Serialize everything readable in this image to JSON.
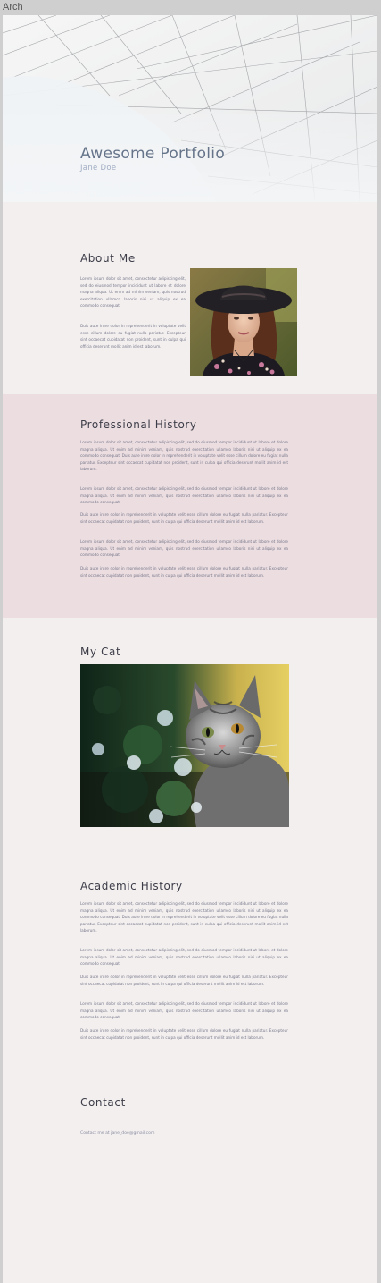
{
  "window": {
    "title": "Arch"
  },
  "hero": {
    "title": "Awesome Portfolio",
    "subtitle": "Jane Doe"
  },
  "about": {
    "heading": "About Me",
    "paragraphs": [
      "Lorem ipsum dolor sit amet, consectetur adipiscing elit, sed do eiusmod tempor incididunt ut labore et dolore magna aliqua. Ut enim ad minim veniam, quis nostrud exercitation ullamco laboris nisi ut aliquip ex ea commodo consequat.",
      "Duis aute irure dolor in reprehenderit in voluptate velit esse cillum dolore eu fugiat nulla pariatur. Excepteur sint occaecat cupidatat non proident, sunt in culpa qui officia deserunt mollit anim id est laborum."
    ],
    "photo_alt": "portrait-woman-hat"
  },
  "professional": {
    "heading": "Professional History",
    "paragraphs": [
      "Lorem ipsum dolor sit amet, consectetur adipiscing elit, sed do eiusmod tempor incididunt ut labore et dolore magna aliqua. Ut enim ad minim veniam, quis nostrud exercitation ullamco laboris nisi ut aliquip ex ea commodo consequat. Duis aute irure dolor in reprehenderit in voluptate velit esse cillum dolore eu fugiat nulla pariatur. Excepteur sint occaecat cupidatat non proident, sunt in culpa qui officia deserunt mollit anim id est laborum.",
      "Lorem ipsum dolor sit amet, consectetur adipiscing elit, sed do eiusmod tempor incididunt ut labore et dolore magna aliqua. Ut enim ad minim veniam, quis nostrud exercitation ullamco laboris nisi ut aliquip ex ea commodo consequat.",
      "Duis aute irure dolor in reprehenderit in voluptate velit esse cillum dolore eu fugiat nulla pariatur. Excepteur sint occaecat cupidatat non proident, sunt in culpa qui officia deserunt mollit anim id est laborum.",
      "Lorem ipsum dolor sit amet, consectetur adipiscing elit, sed do eiusmod tempor incididunt ut labore et dolore magna aliqua. Ut enim ad minim veniam, quis nostrud exercitation ullamco laboris nisi ut aliquip ex ea commodo consequat.",
      "Duis aute irure dolor in reprehenderit in voluptate velit esse cillum dolore eu fugiat nulla pariatur. Excepteur sint occaecat cupidatat non proident, sunt in culpa qui officia deserunt mollit anim id est laborum."
    ]
  },
  "cat": {
    "heading": "My Cat",
    "photo_alt": "cat-photo"
  },
  "academic": {
    "heading": "Academic History",
    "paragraphs": [
      "Lorem ipsum dolor sit amet, consectetur adipiscing elit, sed do eiusmod tempor incididunt ut labore et dolore magna aliqua. Ut enim ad minim veniam, quis nostrud exercitation ullamco laboris nisi ut aliquip ex ea commodo consequat. Duis aute irure dolor in reprehenderit in voluptate velit esse cillum dolore eu fugiat nulla pariatur. Excepteur sint occaecat cupidatat non proident, sunt in culpa qui officia deserunt mollit anim id est laborum.",
      "Lorem ipsum dolor sit amet, consectetur adipiscing elit, sed do eiusmod tempor incididunt ut labore et dolore magna aliqua. Ut enim ad minim veniam, quis nostrud exercitation ullamco laboris nisi ut aliquip ex ea commodo consequat.",
      "Duis aute irure dolor in reprehenderit in voluptate velit esse cillum dolore eu fugiat nulla pariatur. Excepteur sint occaecat cupidatat non proident, sunt in culpa qui officia deserunt mollit anim id est laborum.",
      "Lorem ipsum dolor sit amet, consectetur adipiscing elit, sed do eiusmod tempor incididunt ut labore et dolore magna aliqua. Ut enim ad minim veniam, quis nostrud exercitation ullamco laboris nisi ut aliquip ex ea commodo consequat.",
      "Duis aute irure dolor in reprehenderit in voluptate velit esse cillum dolore eu fugiat nulla pariatur. Excepteur sint occaecat cupidatat non proident, sunt in culpa qui officia deserunt mollit anim id est laborum."
    ]
  },
  "contact": {
    "heading": "Contact",
    "text": "Contact me at jane_doe@gmail.com"
  },
  "colors": {
    "page_bg": "#f3efef",
    "prof_bg": "#ebdde0",
    "hero_title": "#66748a",
    "heading": "#3d3d48",
    "body_text": "#77788a"
  }
}
